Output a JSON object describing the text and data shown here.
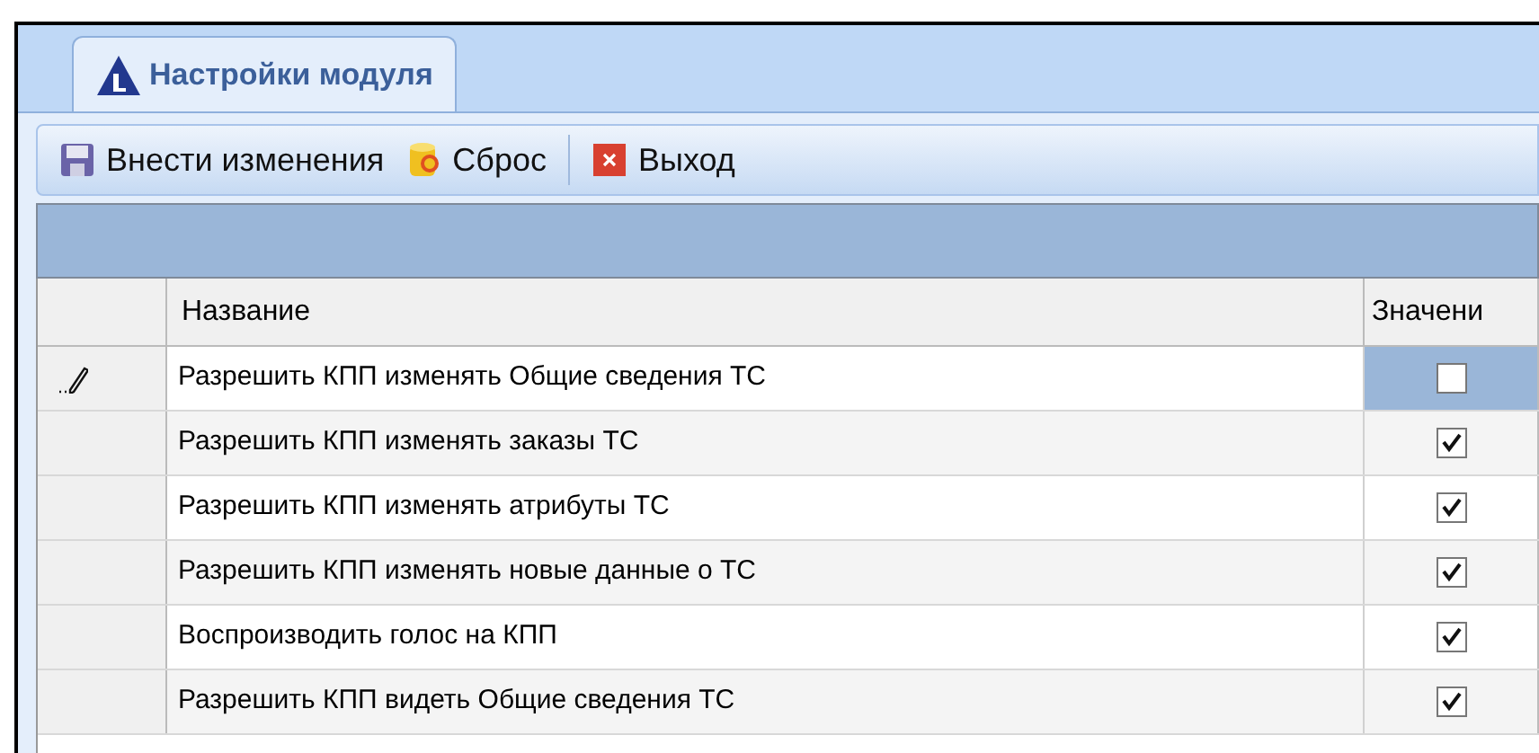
{
  "tabs": [
    {
      "label": "Настройки модуля",
      "selected": true
    }
  ],
  "toolbar": [
    {
      "kind": "save",
      "label": "Внести изменения"
    },
    {
      "kind": "reset",
      "label": "Сброс"
    },
    {
      "kind": "exit",
      "label": "Выход"
    }
  ],
  "table": {
    "columns": [
      "Название",
      "Значени"
    ],
    "rows": [
      {
        "name": "Разрешить КПП изменять Общие сведения ТС",
        "checked": false,
        "selected": true
      },
      {
        "name": "Разрешить КПП изменять заказы ТС",
        "checked": true,
        "selected": false
      },
      {
        "name": "Разрешить КПП изменять атрибуты ТС",
        "checked": true,
        "selected": false
      },
      {
        "name": "Разрешить КПП изменять новые данные о ТС",
        "checked": true,
        "selected": false
      },
      {
        "name": "Воспроизводить голос на КПП",
        "checked": true,
        "selected": false
      },
      {
        "name": "Разрешить КПП видеть Общие сведения ТС",
        "checked": true,
        "selected": false
      }
    ]
  }
}
